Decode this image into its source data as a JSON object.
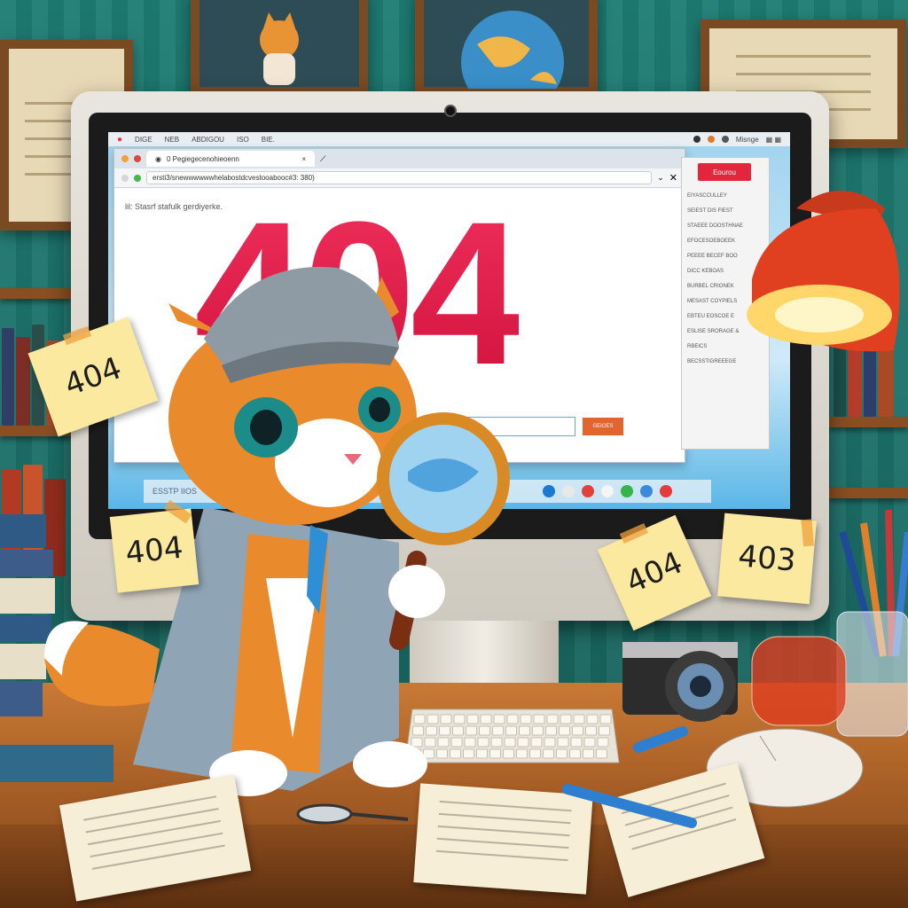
{
  "scene": {
    "description_free": true
  },
  "screen": {
    "menubar": {
      "items": [
        "DIGE",
        "NEB",
        "ABDIGOU",
        "ISO",
        "BIE."
      ],
      "right_label": "Misnge"
    },
    "browser": {
      "tab_label": "0 Pegiegecenohieoenn",
      "url": "ersti3/snewwwwwwhelabostdcvestooabooc#3: 380)",
      "page_note": "lil: Stasrf stafulk gerdiyerke.",
      "error_code": "404",
      "go_button_label": "GEIOES"
    },
    "side_panel": {
      "button_label": "Eourou",
      "lines": [
        "EIYASCCULLEY",
        "SEIEST DIS FIEST",
        "STAEEE DOOSTHNAE",
        "EFOCESOEBOEEK",
        "PEEEE BECEF BOO",
        "DICC KEBOAS",
        "BURBEL CRIONEK",
        "MESAST COYPIELS",
        "EBTEU EOSCOE E",
        "ESLISE SRORAGE &",
        "RBEICS",
        "BECSSTIGREEEGE"
      ]
    },
    "dock_label": "ESSTP IIOS"
  },
  "sticky_notes": [
    {
      "id": "left",
      "text": "404"
    },
    {
      "id": "lower-left",
      "text": "404"
    },
    {
      "id": "right",
      "text": "404"
    },
    {
      "id": "far-right",
      "text": "403"
    }
  ],
  "colors": {
    "error_red": "#ea1d48",
    "wall_teal": "#1e7d74",
    "desk_wood": "#c87a35",
    "sticky_yellow": "#fbe9a0",
    "lamp_red": "#e0401f",
    "cat_orange": "#e98a2c"
  }
}
